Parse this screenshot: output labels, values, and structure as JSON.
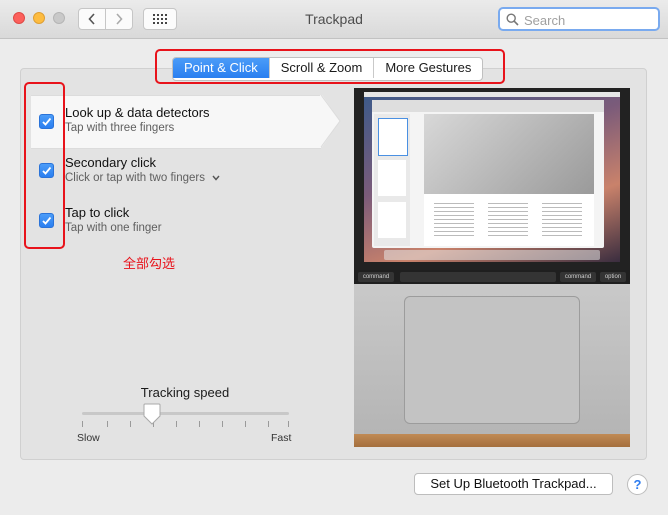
{
  "window": {
    "title": "Trackpad"
  },
  "toolbar": {
    "search_placeholder": "Search"
  },
  "tabs": [
    {
      "label": "Point & Click",
      "active": true
    },
    {
      "label": "Scroll & Zoom",
      "active": false
    },
    {
      "label": "More Gestures",
      "active": false
    }
  ],
  "options": [
    {
      "title": "Look up & data detectors",
      "subtitle": "Tap with three fingers",
      "checked": true
    },
    {
      "title": "Secondary click",
      "subtitle": "Click or tap with two fingers",
      "checked": true
    },
    {
      "title": "Tap to click",
      "subtitle": "Tap with one finger",
      "checked": true
    }
  ],
  "annotation": {
    "text": "全部勾选",
    "color": "#e8131b"
  },
  "tracking": {
    "label": "Tracking speed",
    "slow": "Slow",
    "fast": "Fast",
    "value": 0.34
  },
  "preview": {
    "keys": {
      "command": "command",
      "option": "option"
    }
  },
  "footer": {
    "setup_button": "Set Up Bluetooth Trackpad...",
    "help_button": "?"
  },
  "colors": {
    "accent": "#2b7ff0",
    "annotation_red": "#e8131b"
  }
}
